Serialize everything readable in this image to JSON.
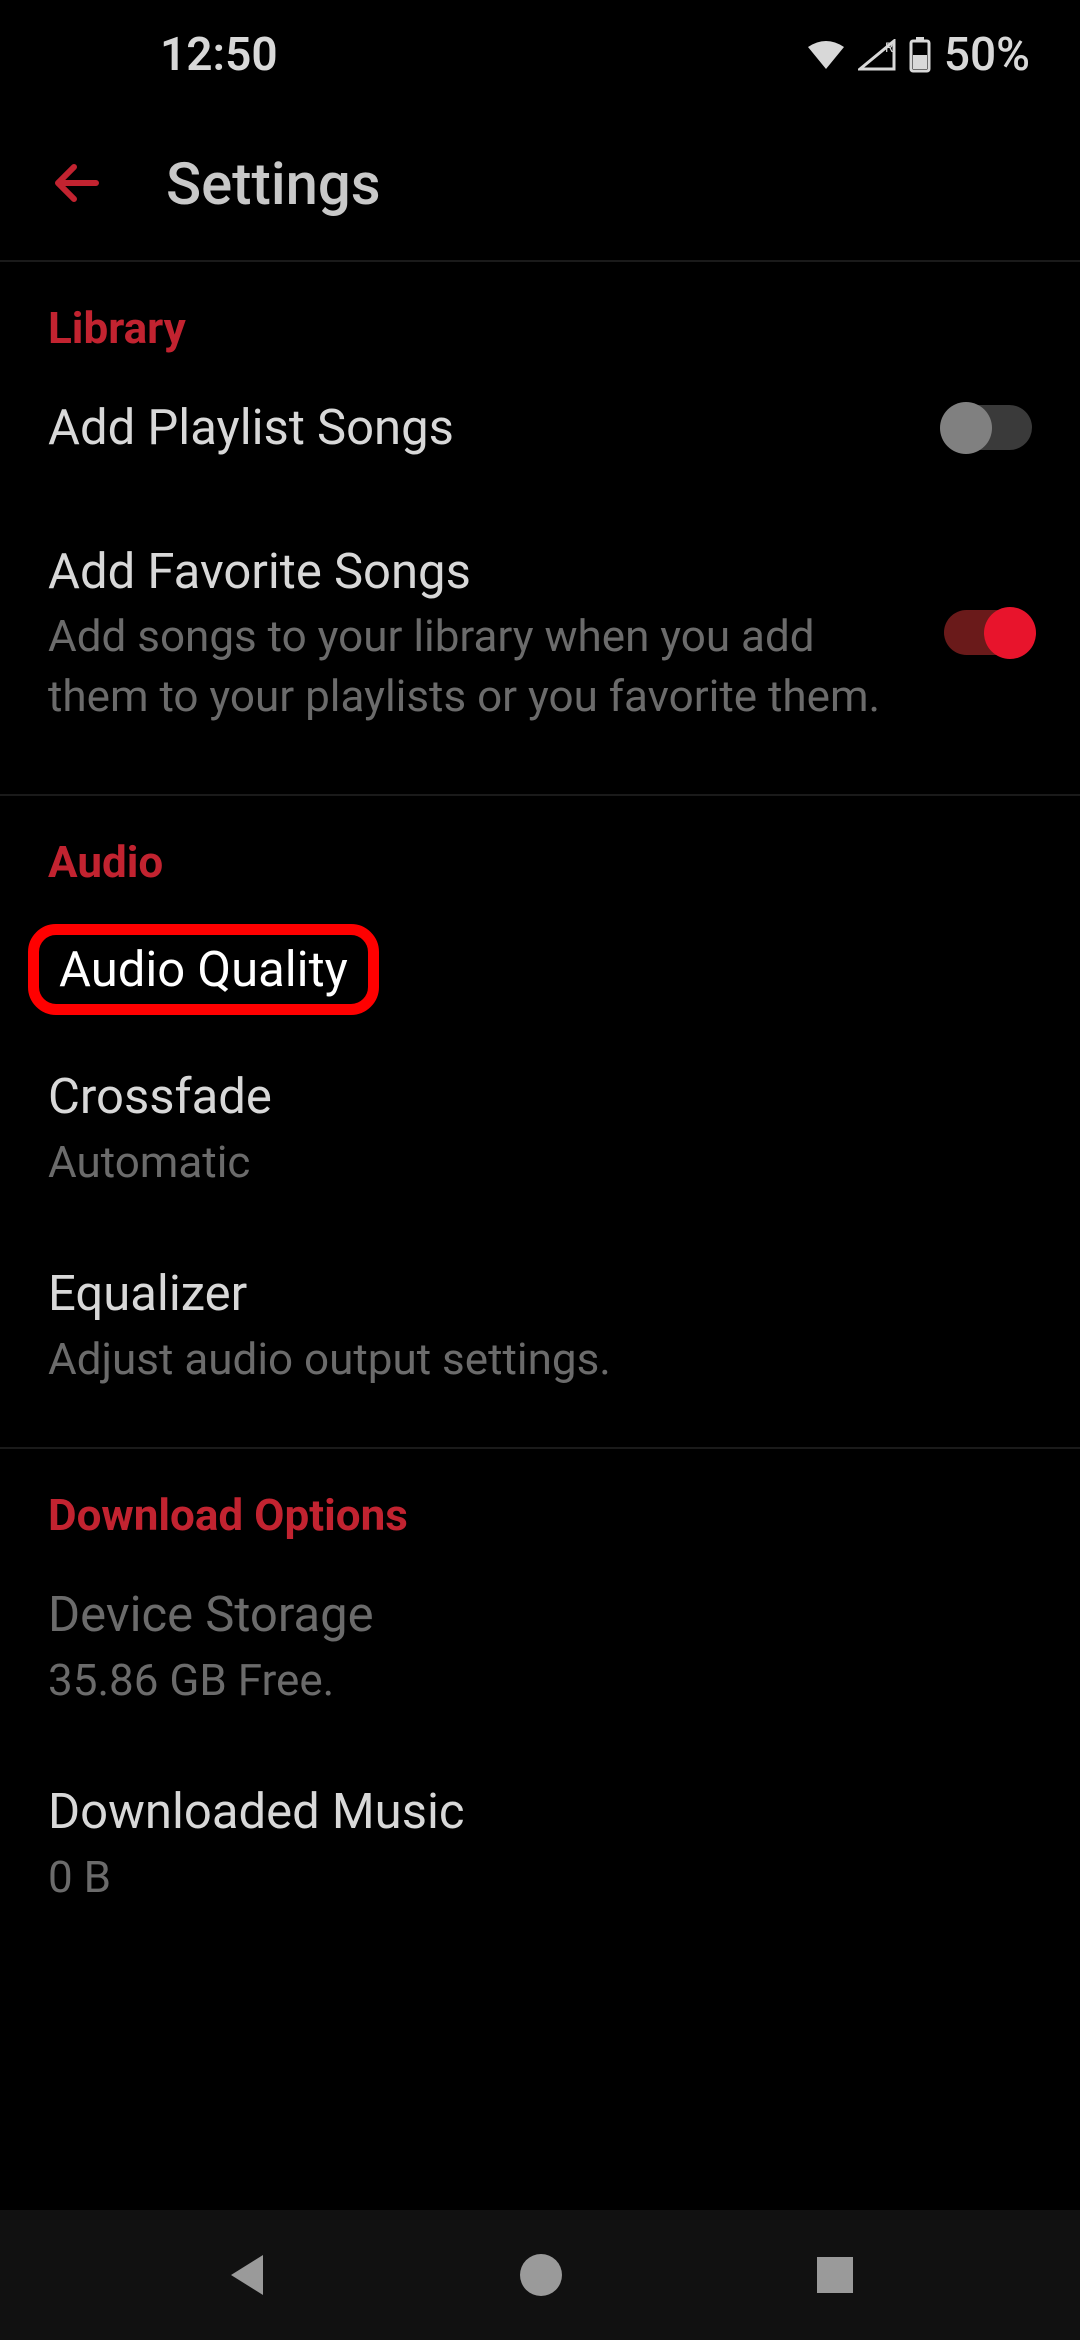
{
  "status_bar": {
    "time": "12:50",
    "battery": "50%"
  },
  "header": {
    "title": "Settings"
  },
  "sections": {
    "library": {
      "header": "Library",
      "add_playlist_songs": {
        "title": "Add Playlist Songs",
        "toggle": false
      },
      "add_favorite_songs": {
        "title": "Add Favorite Songs",
        "subtitle": "Add songs to your library when you add them to your playlists or you favorite them.",
        "toggle": true
      }
    },
    "audio": {
      "header": "Audio",
      "audio_quality": {
        "title": "Audio Quality"
      },
      "crossfade": {
        "title": "Crossfade",
        "subtitle": "Automatic"
      },
      "equalizer": {
        "title": "Equalizer",
        "subtitle": "Adjust audio output settings."
      }
    },
    "download": {
      "header": "Download Options",
      "device_storage": {
        "title": "Device Storage",
        "subtitle": "35.86 GB Free."
      },
      "downloaded_music": {
        "title": "Downloaded Music",
        "subtitle": "0 B"
      }
    }
  }
}
